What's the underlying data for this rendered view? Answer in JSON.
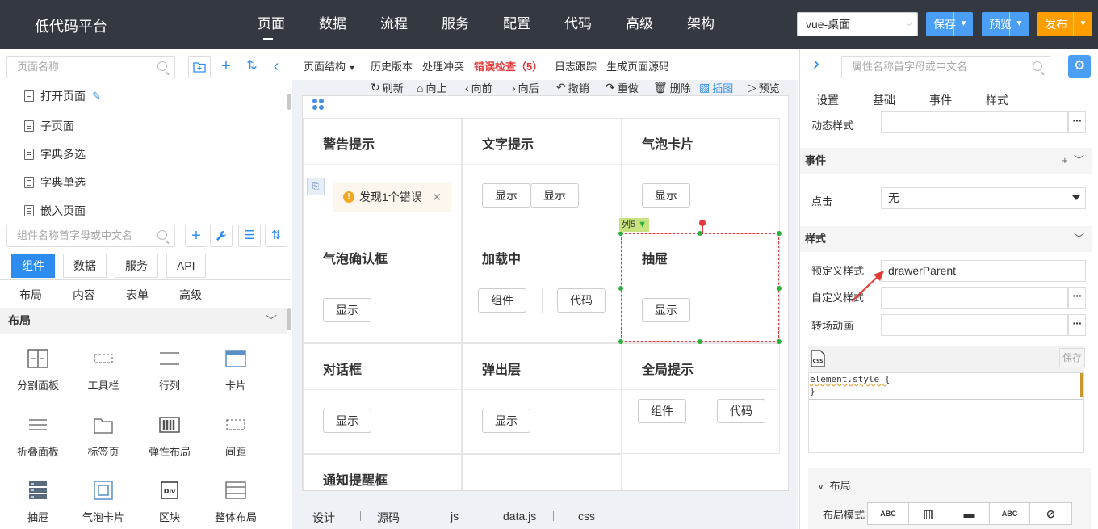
{
  "app": {
    "brand": "低代码平台",
    "nav": [
      "页面",
      "数据",
      "流程",
      "服务",
      "配置",
      "代码",
      "高级",
      "架构"
    ],
    "page_select": "vue-桌面",
    "save": "保存",
    "preview": "预览",
    "publish": "发布"
  },
  "left": {
    "page_search_placeholder": "页面名称",
    "pages": [
      "打开页面",
      "子页面",
      "字典多选",
      "字典单选",
      "嵌入页面"
    ],
    "comp_search_placeholder": "组件名称首字母或中文名",
    "cat_tabs": [
      "组件",
      "数据",
      "服务",
      "API"
    ],
    "sub_tabs": [
      "布局",
      "内容",
      "表单",
      "高级"
    ],
    "section": "布局",
    "components": [
      {
        "label": "分割面板",
        "icon": "split-panel-icon"
      },
      {
        "label": "工具栏",
        "icon": "toolbar-icon"
      },
      {
        "label": "行列",
        "icon": "row-col-icon"
      },
      {
        "label": "卡片",
        "icon": "card-icon"
      },
      {
        "label": "折叠面板",
        "icon": "collapse-icon"
      },
      {
        "label": "标签页",
        "icon": "tabs-icon"
      },
      {
        "label": "弹性布局",
        "icon": "flex-icon"
      },
      {
        "label": "间距",
        "icon": "spacing-icon"
      },
      {
        "label": "抽屉",
        "icon": "drawer-icon"
      },
      {
        "label": "气泡卡片",
        "icon": "popover-icon"
      },
      {
        "label": "区块",
        "icon": "div-icon"
      },
      {
        "label": "整体布局",
        "icon": "layout-icon"
      }
    ]
  },
  "center": {
    "toolbar": {
      "structure": "页面结构",
      "history": "历史版本",
      "conflict": "处理冲突",
      "error_check": "错误检查（5）",
      "log": "日志跟踪",
      "gen_source": "生成页面源码"
    },
    "actions": [
      "刷新",
      "向上",
      "向前",
      "向后",
      "撤销",
      "重做",
      "删除",
      "插图",
      "预览"
    ],
    "cells": [
      {
        "title": "警告提示"
      },
      {
        "title": "文字提示",
        "buttons": [
          "显示",
          "显示"
        ]
      },
      {
        "title": "气泡卡片",
        "buttons": [
          "显示"
        ]
      },
      {
        "title": "气泡确认框",
        "buttons": [
          "显示"
        ]
      },
      {
        "title": "加载中",
        "buttons": [
          "组件",
          "代码"
        ]
      },
      {
        "title": "抽屉",
        "buttons": [
          "显示"
        ]
      },
      {
        "title": "对话框",
        "buttons": [
          "显示"
        ]
      },
      {
        "title": "弹出层",
        "buttons": [
          "显示"
        ]
      },
      {
        "title": "全局提示",
        "buttons": [
          "组件",
          "代码"
        ]
      },
      {
        "title": "通知提醒框"
      }
    ],
    "toast": "发现1个错误",
    "col_label": "列5",
    "bottom_tabs": [
      "设计",
      "源码",
      "js",
      "data.js",
      "css"
    ]
  },
  "right": {
    "search_placeholder": "属性名称首字母或中文名",
    "tabs": [
      "设置",
      "基础",
      "事件",
      "样式"
    ],
    "dynamic_style_label": "动态样式",
    "events_section": "事件",
    "click_label": "点击",
    "click_value": "无",
    "style_section": "样式",
    "predefined_label": "预定义样式",
    "predefined_value": "drawerParent",
    "custom_label": "自定义样式",
    "transition_label": "转场动画",
    "save_small": "保存",
    "code_line1": "element.style {",
    "code_line2": "}",
    "layout_section": "布局",
    "layout_mode_label": "布局模式",
    "layout_modes": [
      "ABC",
      "▥",
      "▬",
      "ABC",
      "⊘"
    ]
  }
}
